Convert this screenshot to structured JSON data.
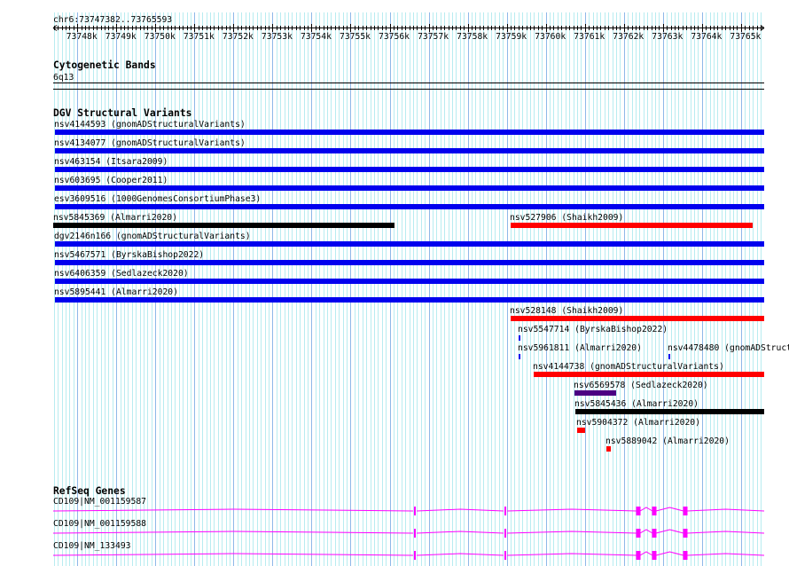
{
  "region": {
    "label": "chr6:73747382..73765593",
    "start": 73747382,
    "end": 73765593
  },
  "ruler": {
    "ticks_kb": [
      73748,
      73749,
      73750,
      73751,
      73752,
      73753,
      73754,
      73755,
      73756,
      73757,
      73758,
      73759,
      73760,
      73761,
      73762,
      73763,
      73764,
      73765
    ],
    "suffix": "k"
  },
  "colors": {
    "grid_minor": "#b8ecf0",
    "grid_major": "#8fb8e8",
    "blue": "#0000ee",
    "red": "#ff0000",
    "black": "#000000",
    "purple": "#4b0082",
    "gene": "#ff00ff"
  },
  "cytobands": {
    "title": "Cytogenetic Bands",
    "band": "6q13"
  },
  "dgv": {
    "title": "DGV Structural Variants",
    "rows": [
      [
        {
          "id": "nsv4144593",
          "study": "gnomADStructuralVariants",
          "start": 73747427,
          "end": 73765593,
          "color": "blue"
        }
      ],
      [
        {
          "id": "nsv4134077",
          "study": "gnomADStructuralVariants",
          "start": 73747427,
          "end": 73765593,
          "color": "blue"
        }
      ],
      [
        {
          "id": "nsv463154",
          "study": "Itsara2009",
          "start": 73747427,
          "end": 73765593,
          "color": "blue"
        }
      ],
      [
        {
          "id": "nsv603695",
          "study": "Cooper2011",
          "start": 73747427,
          "end": 73765593,
          "color": "blue"
        }
      ],
      [
        {
          "id": "esv3609516",
          "study": "1000GenomesConsortiumPhase3",
          "start": 73747427,
          "end": 73765593,
          "color": "blue"
        }
      ],
      [
        {
          "id": "nsv5845369",
          "study": "Almarri2020",
          "start": 73747382,
          "end": 73756124,
          "color": "black"
        },
        {
          "id": "nsv527906",
          "study": "Shaikh2009",
          "start": 73759099,
          "end": 73765298,
          "color": "red"
        }
      ],
      [
        {
          "id": "dgv2146n166",
          "study": "gnomADStructuralVariants",
          "start": 73747427,
          "end": 73765593,
          "color": "blue"
        }
      ],
      [
        {
          "id": "nsv5467571",
          "study": "ByrskaBishop2022",
          "start": 73747427,
          "end": 73765593,
          "color": "blue"
        }
      ],
      [
        {
          "id": "nsv6406359",
          "study": "Sedlazeck2020",
          "start": 73747427,
          "end": 73765593,
          "color": "blue"
        }
      ],
      [
        {
          "id": "nsv5895441",
          "study": "Almarri2020",
          "start": 73747427,
          "end": 73765593,
          "color": "blue"
        }
      ],
      [
        {
          "id": "nsv528148",
          "study": "Shaikh2009",
          "start": 73759099,
          "end": 73765593,
          "color": "red"
        }
      ],
      [
        {
          "id": "nsv5547714",
          "study": "ByrskaBishop2022",
          "start": 73759303,
          "end": 73759326,
          "color": "blue"
        }
      ],
      [
        {
          "id": "nsv5961811",
          "study": "Almarri2020",
          "start": 73759303,
          "end": 73759326,
          "color": "blue"
        },
        {
          "id": "nsv4478480",
          "study": "gnomADStructuralVariants",
          "start": 73763141,
          "end": 73763164,
          "color": "blue"
        }
      ],
      [
        {
          "id": "nsv4144738",
          "study": "gnomADStructuralVariants",
          "start": 73759689,
          "end": 73765593,
          "color": "red"
        }
      ],
      [
        {
          "id": "nsv6569578",
          "study": "Sedlazeck2020",
          "start": 73760734,
          "end": 73761801,
          "color": "purple"
        }
      ],
      [
        {
          "id": "nsv5845436",
          "study": "Almarri2020",
          "start": 73760757,
          "end": 73765593,
          "color": "black"
        }
      ],
      [
        {
          "id": "nsv5904372",
          "study": "Almarri2020",
          "start": 73760802,
          "end": 73761006,
          "color": "red"
        }
      ],
      [
        {
          "id": "nsv5889042",
          "study": "Almarri2020",
          "start": 73761551,
          "end": 73761665,
          "color": "red"
        }
      ]
    ]
  },
  "refseq": {
    "title": "RefSeq Genes",
    "genes": [
      {
        "label": "CD109|NM_001159587"
      },
      {
        "label": "CD109|NM_001159588"
      },
      {
        "label": "CD109|NM_133493"
      }
    ],
    "exons": [
      73756646,
      73758963,
      73762369,
      73762777,
      73763572
    ]
  }
}
